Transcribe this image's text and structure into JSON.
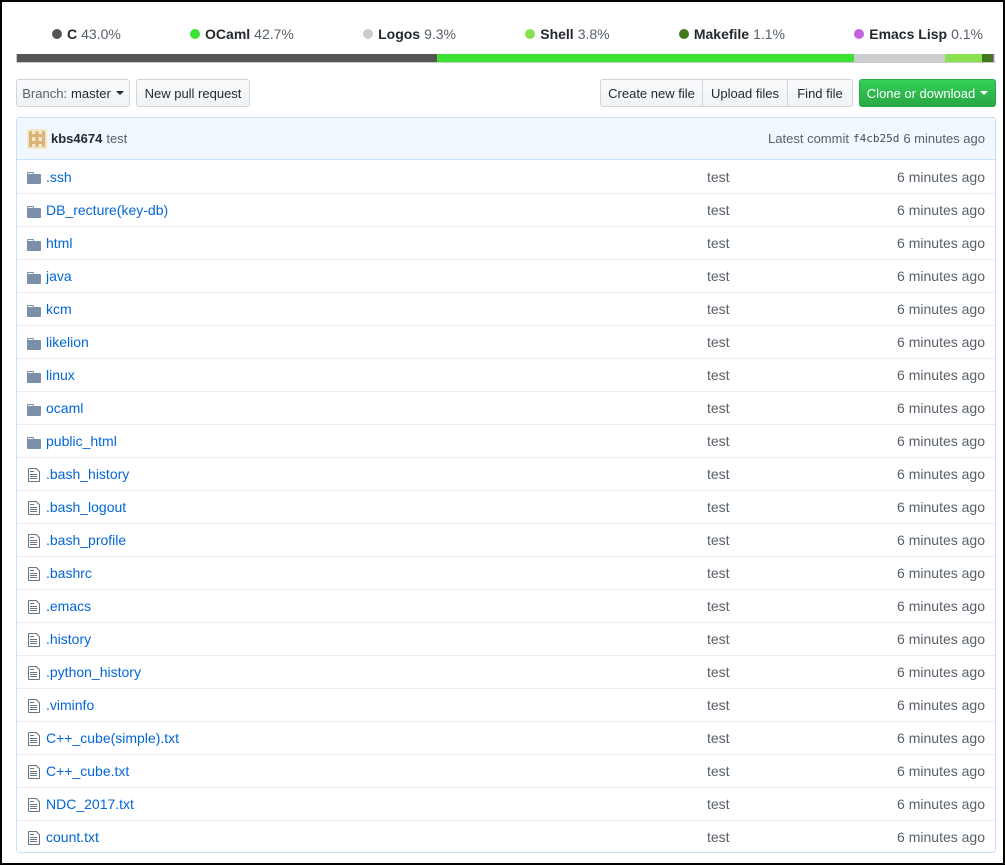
{
  "languages": [
    {
      "name": "C",
      "percent": "43.0%",
      "color": "#555555",
      "share": 43.0
    },
    {
      "name": "OCaml",
      "percent": "42.7%",
      "color": "#3be133",
      "share": 42.7
    },
    {
      "name": "Logos",
      "percent": "9.3%",
      "color": "#cccccc",
      "share": 9.3
    },
    {
      "name": "Shell",
      "percent": "3.8%",
      "color": "#89e051",
      "share": 3.8
    },
    {
      "name": "Makefile",
      "percent": "1.1%",
      "color": "#427819",
      "share": 1.1
    },
    {
      "name": "Emacs Lisp",
      "percent": "0.1%",
      "color": "#c065db",
      "share": 0.1
    }
  ],
  "toolbar": {
    "branch_prefix": "Branch:",
    "branch_name": "master",
    "new_pull_request": "New pull request",
    "create_new_file": "Create new file",
    "upload_files": "Upload files",
    "find_file": "Find file",
    "clone_or_download": "Clone or download"
  },
  "commit": {
    "author": "kbs4674",
    "message": "test",
    "latest_label": "Latest commit",
    "sha": "f4cb25d",
    "age": "6 minutes ago"
  },
  "files": [
    {
      "name": ".ssh",
      "type": "dir",
      "message": "test",
      "age": "6 minutes ago"
    },
    {
      "name": "DB_recture(key-db)",
      "type": "dir",
      "message": "test",
      "age": "6 minutes ago"
    },
    {
      "name": "html",
      "type": "dir",
      "message": "test",
      "age": "6 minutes ago"
    },
    {
      "name": "java",
      "type": "dir",
      "message": "test",
      "age": "6 minutes ago"
    },
    {
      "name": "kcm",
      "type": "dir",
      "message": "test",
      "age": "6 minutes ago"
    },
    {
      "name": "likelion",
      "type": "dir",
      "message": "test",
      "age": "6 minutes ago"
    },
    {
      "name": "linux",
      "type": "dir",
      "message": "test",
      "age": "6 minutes ago"
    },
    {
      "name": "ocaml",
      "type": "dir",
      "message": "test",
      "age": "6 minutes ago"
    },
    {
      "name": "public_html",
      "type": "dir",
      "message": "test",
      "age": "6 minutes ago"
    },
    {
      "name": ".bash_history",
      "type": "file",
      "message": "test",
      "age": "6 minutes ago"
    },
    {
      "name": ".bash_logout",
      "type": "file",
      "message": "test",
      "age": "6 minutes ago"
    },
    {
      "name": ".bash_profile",
      "type": "file",
      "message": "test",
      "age": "6 minutes ago"
    },
    {
      "name": ".bashrc",
      "type": "file",
      "message": "test",
      "age": "6 minutes ago"
    },
    {
      "name": ".emacs",
      "type": "file",
      "message": "test",
      "age": "6 minutes ago"
    },
    {
      "name": ".history",
      "type": "file",
      "message": "test",
      "age": "6 minutes ago"
    },
    {
      "name": ".python_history",
      "type": "file",
      "message": "test",
      "age": "6 minutes ago"
    },
    {
      "name": ".viminfo",
      "type": "file",
      "message": "test",
      "age": "6 minutes ago"
    },
    {
      "name": "C++_cube(simple).txt",
      "type": "file",
      "message": "test",
      "age": "6 minutes ago"
    },
    {
      "name": "C++_cube.txt",
      "type": "file",
      "message": "test",
      "age": "6 minutes ago"
    },
    {
      "name": "NDC_2017.txt",
      "type": "file",
      "message": "test",
      "age": "6 minutes ago"
    },
    {
      "name": "count.txt",
      "type": "file",
      "message": "test",
      "age": "6 minutes ago"
    }
  ],
  "icons": {
    "directory": "folder-icon",
    "file": "file-icon",
    "dropdown": "caret-down-icon"
  },
  "colors": {
    "link": "#0366d6",
    "green_button": "#28a745",
    "commit_bg": "#f1f8ff"
  }
}
